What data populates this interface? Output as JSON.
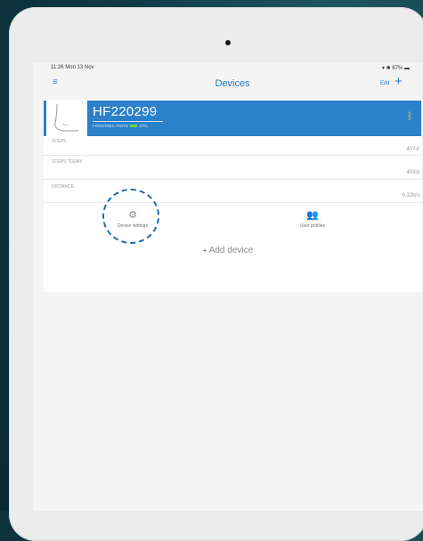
{
  "status_bar": {
    "time": "11:26",
    "date": "Mon 13 Nov",
    "battery": "67%"
  },
  "nav": {
    "title": "Devices",
    "edit_label": "Edit"
  },
  "device": {
    "name": "HF220299",
    "subtitle": "FRONTREC F00TD",
    "battery_percent": "57%"
  },
  "metrics": [
    {
      "label": "STEPS",
      "value": "407st"
    },
    {
      "label": "STEPS TODAY",
      "value": "403st"
    },
    {
      "label": "DISTANCE",
      "value": "0.32km"
    }
  ],
  "actions": [
    {
      "label": "Device settings"
    },
    {
      "label": "User profiles"
    }
  ],
  "add_device_label": "Add device",
  "colors": {
    "accent": "#2b81c9",
    "highlight": "#1b6fad",
    "bluetooth": "#e8d547",
    "battery": "#69d34e"
  }
}
